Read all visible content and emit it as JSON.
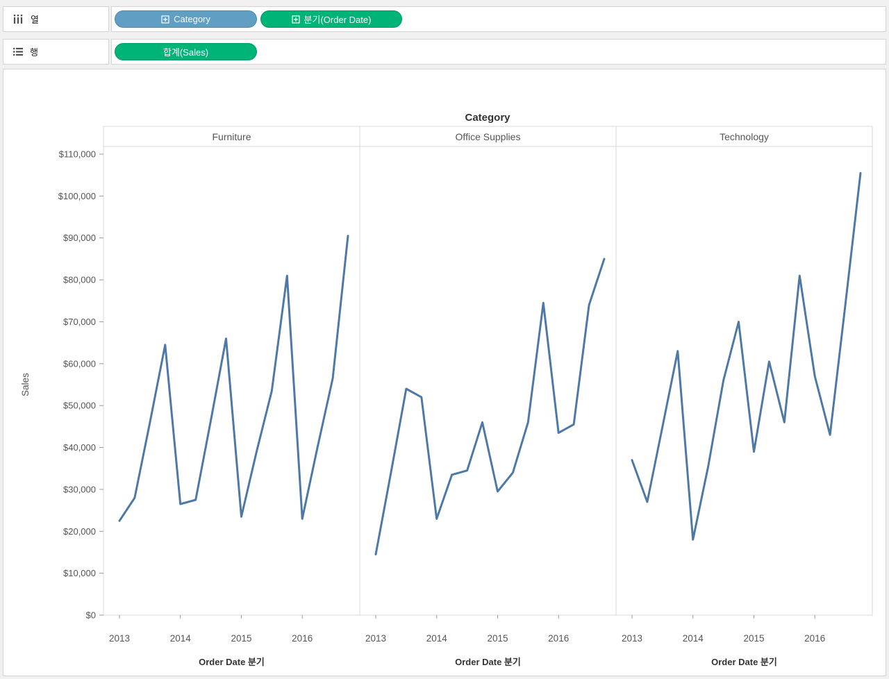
{
  "shelves": {
    "columns": {
      "label": "열",
      "pills": [
        {
          "label": "Category",
          "kind": "dimension",
          "has_expand_icon": true
        },
        {
          "label": "분기(Order Date)",
          "kind": "continuous-date",
          "has_expand_icon": true
        }
      ]
    },
    "rows": {
      "label": "행",
      "pills": [
        {
          "label": "합계(Sales)",
          "kind": "measure",
          "has_expand_icon": false
        }
      ]
    }
  },
  "colors": {
    "dimension_pill": "#5f9fc4",
    "continuous_pill": "#00b377",
    "line": "#4e79a7"
  },
  "chart_data": {
    "type": "line",
    "title": "Category",
    "panels": [
      "Furniture",
      "Office Supplies",
      "Technology"
    ],
    "x": {
      "years": [
        "2013",
        "2014",
        "2015",
        "2016"
      ],
      "points_per_year": 4
    },
    "xlabel": "Order Date 분기",
    "ylabel": "Sales",
    "ylim": [
      0,
      110000
    ],
    "ytick_step": 10000,
    "ytick_labels": [
      "$0",
      "$10,000",
      "$20,000",
      "$30,000",
      "$40,000",
      "$50,000",
      "$60,000",
      "$70,000",
      "$80,000",
      "$90,000",
      "$100,000",
      "$110,000"
    ],
    "legend": "none",
    "grid": "off",
    "series": [
      {
        "name": "Furniture",
        "values": [
          22500,
          28000,
          46000,
          64500,
          26500,
          27500,
          46500,
          66000,
          23500,
          39000,
          53500,
          81000,
          23000,
          40000,
          56500,
          90500
        ]
      },
      {
        "name": "Office Supplies",
        "values": [
          14500,
          34000,
          54000,
          52000,
          23000,
          33500,
          34500,
          46000,
          29500,
          34000,
          46000,
          74500,
          43500,
          45500,
          74000,
          85000
        ]
      },
      {
        "name": "Technology",
        "values": [
          37000,
          27000,
          45000,
          63000,
          18000,
          35500,
          56000,
          70000,
          39000,
          60500,
          46000,
          81000,
          57000,
          43000,
          74000,
          105500
        ]
      }
    ]
  }
}
